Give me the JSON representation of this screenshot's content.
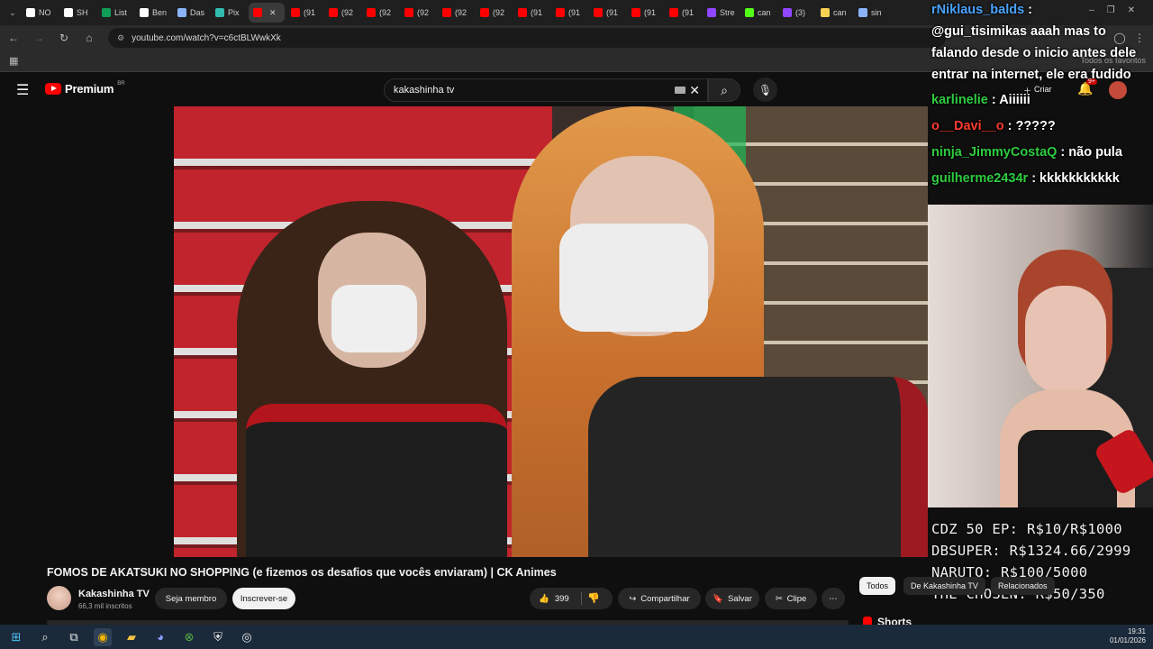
{
  "browser": {
    "tabs": [
      {
        "label": "NO",
        "color": "#ffffff"
      },
      {
        "label": "SH",
        "color": "#ffffff"
      },
      {
        "label": "List",
        "color": "#0f9d58"
      },
      {
        "label": "Ben",
        "color": "#ffffff"
      },
      {
        "label": "Das",
        "color": "#8ab4f8"
      },
      {
        "label": "Pix",
        "color": "#32bcad"
      },
      {
        "label": "",
        "color": "#ff0000"
      },
      {
        "label": "(91",
        "color": "#ff0000"
      },
      {
        "label": "(92",
        "color": "#ff0000"
      },
      {
        "label": "(92",
        "color": "#ff0000"
      },
      {
        "label": "(92",
        "color": "#ff0000"
      },
      {
        "label": "(92",
        "color": "#ff0000"
      },
      {
        "label": "(92",
        "color": "#ff0000"
      },
      {
        "label": "(91",
        "color": "#ff0000"
      },
      {
        "label": "(91",
        "color": "#ff0000"
      },
      {
        "label": "(91",
        "color": "#ff0000"
      },
      {
        "label": "(91",
        "color": "#ff0000"
      },
      {
        "label": "(91",
        "color": "#ff0000"
      },
      {
        "label": "Stre",
        "color": "#9146ff"
      },
      {
        "label": "can",
        "color": "#53fc18"
      },
      {
        "label": "(3)",
        "color": "#9146ff"
      },
      {
        "label": "can",
        "color": "#f7d154"
      },
      {
        "label": "sin",
        "color": "#8ab4f8"
      }
    ],
    "url": "youtube.com/watch?v=c6ctBLWwkXk",
    "bookmarks_all": "Todos os favoritos"
  },
  "youtube": {
    "logo_text": "Premium",
    "logo_region": "BR",
    "search_value": "kakashinha tv",
    "create_label": "Criar",
    "notif_count": "9+"
  },
  "chat": [
    {
      "user": "rNiklaus_balds",
      "user_color": "#4aa3ff",
      "msg": ":"
    },
    {
      "user": "",
      "user_color": "#ffffff",
      "msg": "@gui_tisimikas aaah mas to"
    },
    {
      "user": "",
      "user_color": "#ffffff",
      "msg": "falando desde o inicio antes dele"
    },
    {
      "user": "",
      "user_color": "#ffffff",
      "msg": "entrar na internet, ele era fudido"
    },
    {
      "user": "karlinelie",
      "user_color": "#2ecc40",
      "msg": ": Aiiiiii"
    },
    {
      "user": "o__Davi__o",
      "user_color": "#ff3b30",
      "msg": ": ?????"
    },
    {
      "user": "ninja_JimmyCostaQ",
      "user_color": "#2ecc40",
      "msg": ": não pula"
    },
    {
      "user": "guilherme2434r",
      "user_color": "#2ecc40",
      "msg": ": kkkkkkkkkkk"
    }
  ],
  "overlay_prices": [
    "CDZ 50 EP: R$10/R$1000",
    "DBSUPER: R$1324.66/2999",
    "NARUTO: R$100/5000",
    "THE CHOSEN: R$50/350"
  ],
  "video": {
    "title": "FOMOS DE AKATSUKI NO SHOPPING (e fizemos os desafios que vocês enviaram) | CK Animes",
    "channel": "Kakashinha TV",
    "subscribers": "66,3 mil inscritos",
    "member_label": "Seja membro",
    "subscribe_label": "Inscrever-se",
    "likes": "399",
    "share_label": "Compartilhar",
    "save_label": "Salvar",
    "clip_label": "Clipe"
  },
  "sidebar": {
    "chips": [
      "Todos",
      "De Kakashinha TV",
      "Relacionados"
    ],
    "shorts_label": "Shorts"
  },
  "taskbar": {
    "time": "19:31",
    "date": "01/01/2026"
  }
}
